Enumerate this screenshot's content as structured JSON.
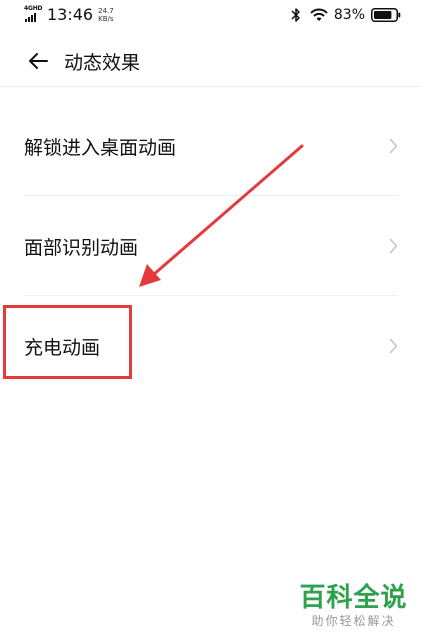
{
  "status_bar": {
    "network_label": "4GHD",
    "time": "13:46",
    "speed_value": "24.7",
    "speed_unit": "KB/s",
    "battery_percent": "83%",
    "icons": [
      "signal-icon",
      "bluetooth-icon",
      "wifi-icon",
      "battery-icon"
    ],
    "battery_level": 0.83
  },
  "header": {
    "back_icon": "arrow-left-icon",
    "title": "动态效果"
  },
  "settings": {
    "items": [
      {
        "label": "解锁进入桌面动画",
        "icon": "chevron-right-icon"
      },
      {
        "label": "面部识别动画",
        "icon": "chevron-right-icon"
      },
      {
        "label": "充电动画",
        "icon": "chevron-right-icon"
      }
    ]
  },
  "annotation": {
    "arrow_color": "#e43a3c",
    "box_color": "#e43a3c"
  },
  "watermark": {
    "title": "百科全说",
    "subtitle": "助你轻松解决",
    "color": "#2da14b"
  }
}
